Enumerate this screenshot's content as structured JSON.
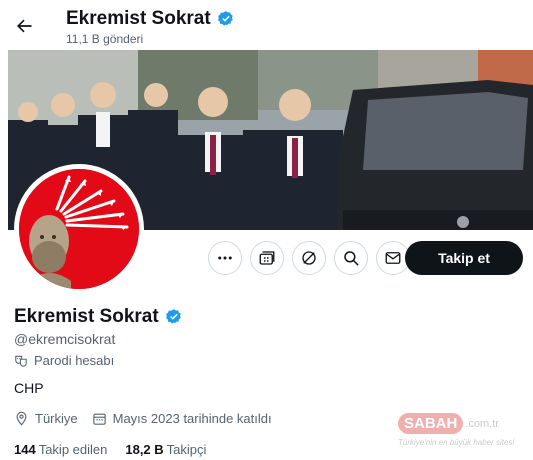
{
  "header": {
    "name": "Ekremist Sokrat",
    "posts_count": "11,1 B gönderi",
    "icons": {
      "back": "arrow-left-icon",
      "verified": "verified-badge-icon"
    }
  },
  "banner": {
    "description_icon": "banner-photo"
  },
  "actions": {
    "more": "more-icon",
    "subscribe": "subscribe-icon",
    "grok": "grok-icon",
    "search": "search-icon",
    "message": "envelope-icon",
    "follow_label": "Takip et"
  },
  "profile": {
    "name": "Ekremist Sokrat",
    "handle": "@ekremcisokrat",
    "parody_label": "Parodi hesabı",
    "bio": "CHP",
    "location": "Türkiye",
    "joined": "Mayıs 2023 tarihinde katıldı",
    "following_count": "144",
    "following_label": "Takip edilen",
    "followers_count": "18,2 B",
    "followers_label": "Takipçi"
  },
  "watermark": {
    "brand": "SABAH",
    "domain": ".com.tr",
    "tagline": "Türkiye'nin en büyük haber sitesi"
  },
  "colors": {
    "accent": "#1d9bf0",
    "follow_bg": "#0f1419",
    "avatar_bg": "#e30a17",
    "text_secondary": "#536471"
  }
}
